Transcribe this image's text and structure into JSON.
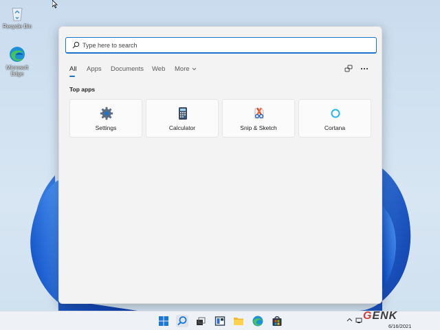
{
  "desktop": {
    "icons": [
      {
        "label": "Recycle Bin",
        "icon": "recycle-bin-icon"
      },
      {
        "label": "Microsoft Edge",
        "icon": "edge-icon"
      }
    ]
  },
  "search": {
    "placeholder": "Type here to search",
    "icon": "search-icon"
  },
  "tabs": [
    {
      "label": "All",
      "active": true
    },
    {
      "label": "Apps"
    },
    {
      "label": "Documents"
    },
    {
      "label": "Web"
    },
    {
      "label": "More"
    }
  ],
  "toolbar": {
    "share_icon": "link-devices-icon",
    "more_icon": "ellipsis-icon"
  },
  "top_apps": {
    "title": "Top apps",
    "items": [
      {
        "label": "Settings",
        "icon": "gear-icon"
      },
      {
        "label": "Calculator",
        "icon": "calculator-icon"
      },
      {
        "label": "Snip & Sketch",
        "icon": "snip-sketch-icon"
      },
      {
        "label": "Cortana",
        "icon": "cortana-icon"
      }
    ]
  },
  "taskbar": {
    "items": [
      "start-icon",
      "search-icon",
      "task-view-icon",
      "widgets-icon",
      "file-explorer-icon",
      "edge-icon",
      "store-icon"
    ]
  },
  "watermark": {
    "text": "ENK",
    "accent": "G"
  },
  "clock": {
    "date": "6/16/2021"
  },
  "colors": {
    "accent": "#1a73c9",
    "panel": "#f3f3f3"
  }
}
